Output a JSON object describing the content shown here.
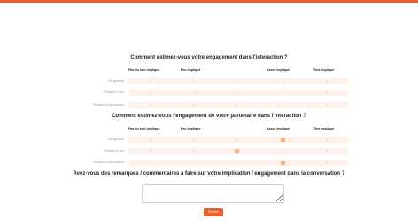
{
  "survey": {
    "accent_color": "#e8612c",
    "scale_labels": [
      "Pas du tout impliqué",
      "Peu impliqué",
      "Assez impliqué",
      "Très impliqué"
    ],
    "questions": [
      {
        "title": "Comment estimez-vous votre engagement dans l'interaction ?",
        "rows": [
          {
            "label": "En général:",
            "value": null
          },
          {
            "label": "Pendant le jeu:",
            "value": null
          },
          {
            "label": "Pendant la discussion:",
            "value": null
          }
        ]
      },
      {
        "title": "Comment estimez-vous l'engagement de votre partenaire dans l'interaction ?",
        "rows": [
          {
            "label": "En général:",
            "value": 0.7
          },
          {
            "label": "Pendant le jeu:",
            "value": 0.49
          },
          {
            "label": "Pendant la discussion:",
            "value": 0.7
          }
        ]
      }
    ],
    "comment_question": "Avez-vous des remarques / commentaires à faire sur votre implication / engagement dans la conversation ?",
    "comment_value": "",
    "submit_label": "Submit"
  }
}
